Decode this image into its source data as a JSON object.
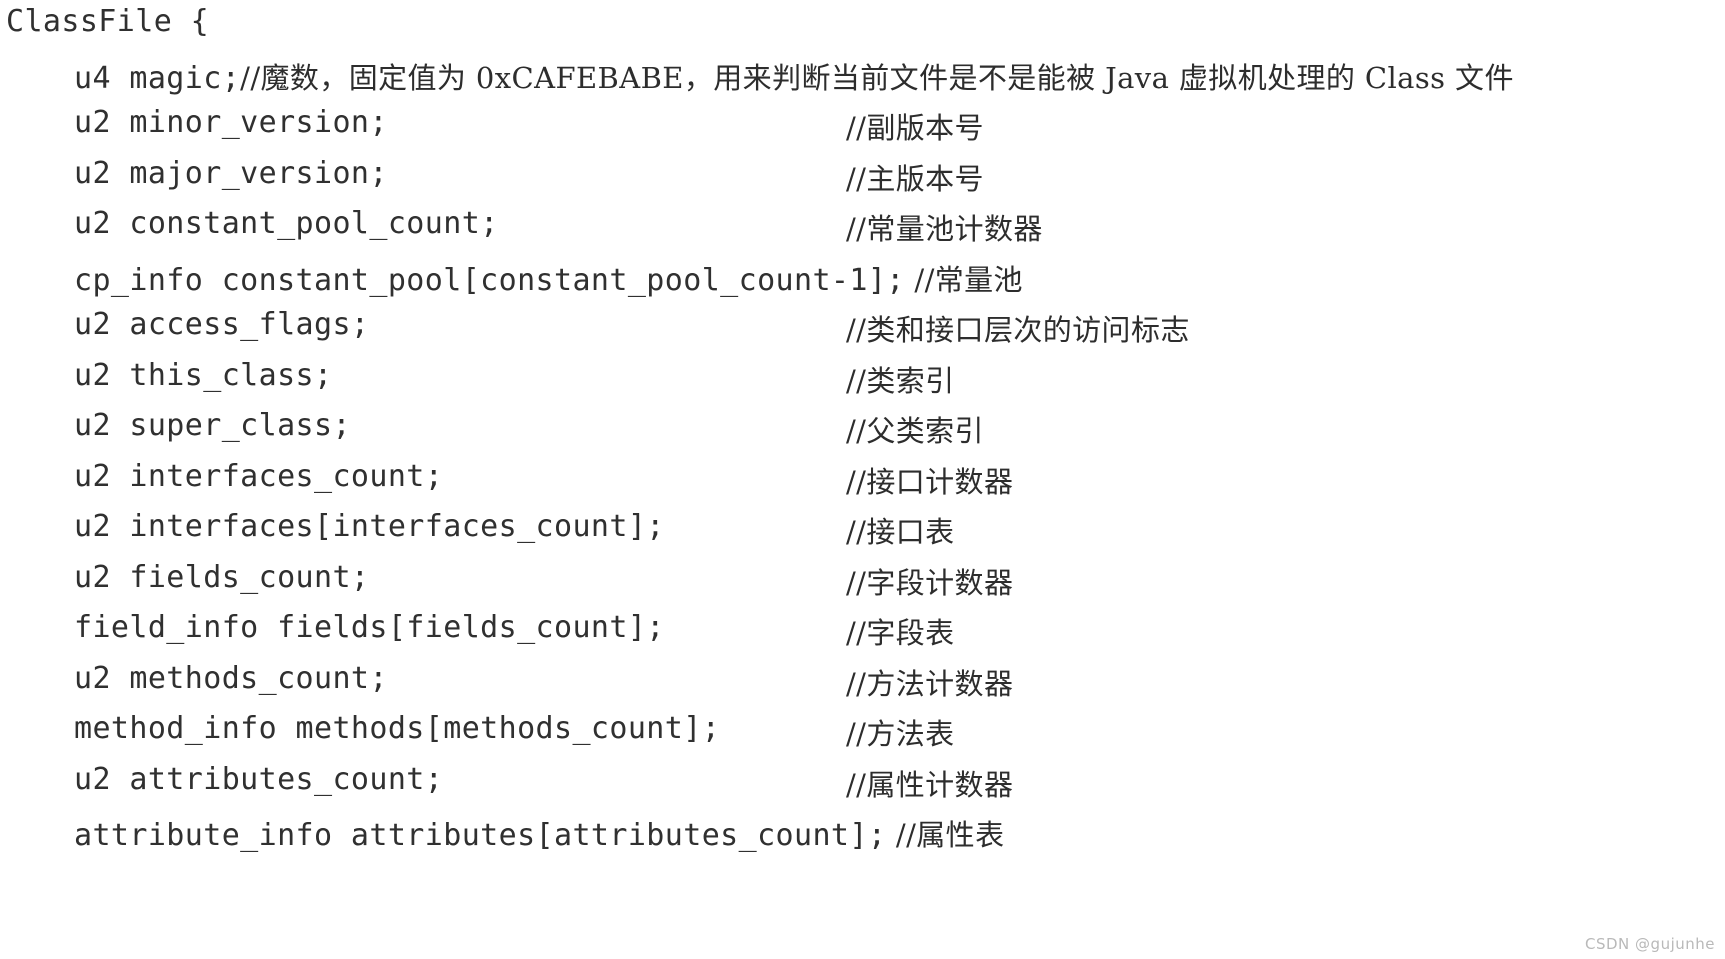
{
  "document": {
    "kind": "code-listing",
    "language": "c-struct-pseudocode",
    "background_color": "#ffffff",
    "text_color": "#2d2d2d",
    "lines": [
      {
        "indent": "none",
        "code": "ClassFile {",
        "comment": "",
        "comment_align": "none"
      },
      {
        "indent": "body",
        "code": "u4 magic;",
        "comment": "//魔数，固定值为 0xCAFEBABE，用来判断当前文件是不是能被 Java 虚拟机处理的 Class 文件",
        "comment_align": "inline"
      },
      {
        "indent": "body",
        "code": "u2 minor_version;",
        "comment": "//副版本号",
        "comment_align": "tab"
      },
      {
        "indent": "body",
        "code": "u2 major_version;",
        "comment": "//主版本号",
        "comment_align": "tab"
      },
      {
        "indent": "body",
        "code": "u2 constant_pool_count;",
        "comment": "//常量池计数器",
        "comment_align": "tab"
      },
      {
        "indent": "body",
        "code": "cp_info constant_pool[constant_pool_count-1];",
        "comment": " //常量池",
        "comment_align": "inline"
      },
      {
        "indent": "body",
        "code": "u2 access_flags;",
        "comment": "//类和接口层次的访问标志",
        "comment_align": "tab"
      },
      {
        "indent": "body",
        "code": "u2 this_class;",
        "comment": "//类索引",
        "comment_align": "tab"
      },
      {
        "indent": "body",
        "code": "u2 super_class;",
        "comment": "//父类索引",
        "comment_align": "tab"
      },
      {
        "indent": "body",
        "code": "u2 interfaces_count;",
        "comment": "//接口计数器",
        "comment_align": "tab"
      },
      {
        "indent": "body",
        "code": "u2 interfaces[interfaces_count];",
        "comment": "//接口表",
        "comment_align": "tab"
      },
      {
        "indent": "body",
        "code": "u2 fields_count;",
        "comment": "//字段计数器",
        "comment_align": "tab"
      },
      {
        "indent": "body",
        "code": "field_info fields[fields_count];",
        "comment": "//字段表",
        "comment_align": "tab"
      },
      {
        "indent": "body",
        "code": "u2 methods_count;",
        "comment": "//方法计数器",
        "comment_align": "tab"
      },
      {
        "indent": "body",
        "code": "method_info methods[methods_count];",
        "comment": "//方法表",
        "comment_align": "tab"
      },
      {
        "indent": "body",
        "code": "u2 attributes_count;",
        "comment": "//属性计数器",
        "comment_align": "tab"
      },
      {
        "indent": "body",
        "code": "attribute_info attributes[attributes_count];",
        "comment": " //属性表",
        "comment_align": "inline"
      }
    ]
  },
  "watermark": {
    "text": "CSDN @gujunhe",
    "color": "#b9b9b9"
  }
}
